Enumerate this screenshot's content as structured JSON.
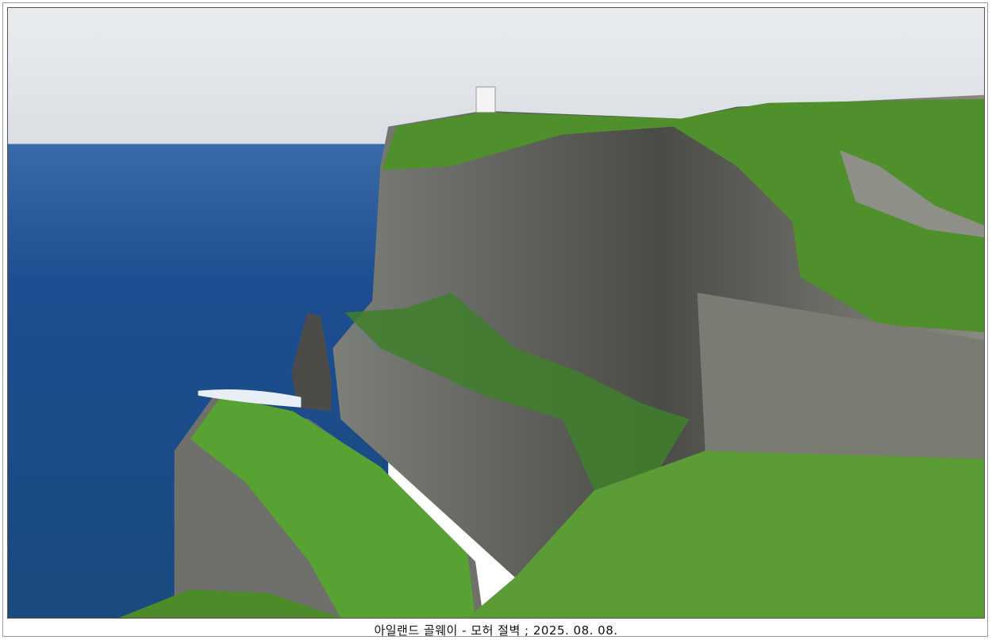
{
  "photo": {
    "subject": "cliffs-of-moher-photo",
    "colors": {
      "sky": "#e4e8ec",
      "sea": "#1f4f8f",
      "grass": "#5a9a30",
      "rock": "#5d5e5a"
    }
  },
  "caption": "아일랜드 골웨이 - 모허 절벽 ; 2025. 08. 08."
}
